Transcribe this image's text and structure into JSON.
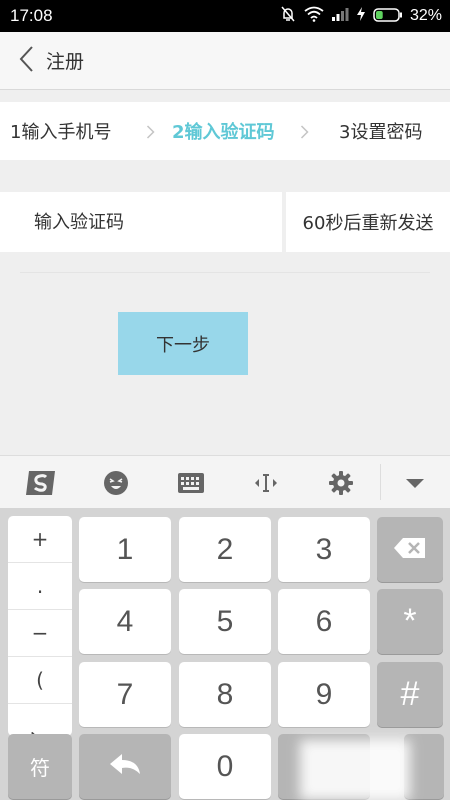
{
  "status_bar": {
    "time": "17:08",
    "battery_percent": "32%",
    "battery_level": 0.32,
    "icons": [
      "mute-icon",
      "wifi-icon",
      "signal-icon",
      "charging-icon",
      "battery-icon"
    ]
  },
  "header": {
    "back_icon": "chevron-left-icon",
    "title": "注册"
  },
  "steps": {
    "step1": "1输入手机号",
    "step2": "2输入验证码",
    "step3": "3设置密码",
    "active_color": "#5fc8d6"
  },
  "verification": {
    "placeholder": "输入验证码",
    "value": "",
    "resend_label": "60秒后重新发送"
  },
  "next_button": {
    "label": "下一步",
    "color": "#98d7ea"
  },
  "ime_toolbar": {
    "icons": [
      "sogou-logo-icon",
      "emoji-icon",
      "keyboard-icon",
      "cursor-move-icon",
      "gear-icon",
      "chevron-down-icon"
    ]
  },
  "keypad": {
    "symbols": [
      "+",
      ".",
      "−",
      "(",
      "、"
    ],
    "digits": [
      "1",
      "2",
      "3",
      "4",
      "5",
      "6",
      "7",
      "8",
      "9",
      "0"
    ],
    "side_keys": [
      "*",
      "#"
    ],
    "sym_label": "符",
    "backspace_icon": "backspace-icon",
    "return_icon": "return-icon"
  }
}
